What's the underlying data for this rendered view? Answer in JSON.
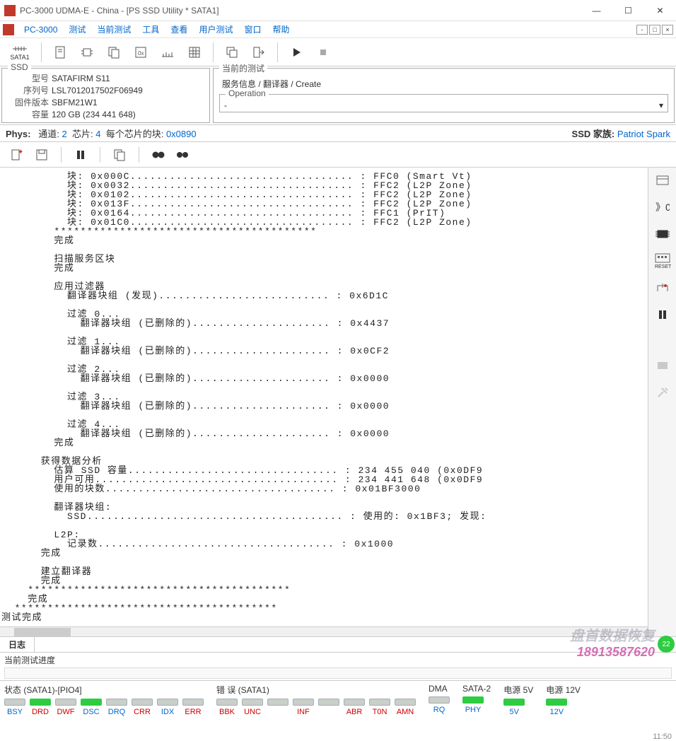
{
  "titlebar": {
    "title": "PC-3000 UDMA-E - China - [PS SSD Utility * SATA1]"
  },
  "menubar": {
    "items": [
      "PC-3000",
      "测试",
      "当前测试",
      "工具",
      "查看",
      "用户测试",
      "窗口",
      "帮助"
    ]
  },
  "toolbar": {
    "sata_label": "SATA1"
  },
  "ssd_panel": {
    "title": "SSD",
    "rows": [
      {
        "label": "型号",
        "value": "SATAFIRM   S11"
      },
      {
        "label": "序列号",
        "value": "LSL7012017502F06949"
      },
      {
        "label": "固件版本",
        "value": "SBFM21W1"
      },
      {
        "label": "容量",
        "value": "120 GB (234 441 648)"
      }
    ]
  },
  "current_test": {
    "title": "当前的测试",
    "breadcrumb": "服务信息 / 翻译器 / Create",
    "op_title": "Operation",
    "op_value": "-"
  },
  "phys": {
    "label": "Phys:",
    "ch_label": "通道:",
    "ch_val": "2",
    "chip_label": "芯片:",
    "chip_val": "4",
    "blk_label": "每个芯片的块:",
    "blk_val": "0x0890",
    "ssd_family_label": "SSD 家族:",
    "ssd_family_val": "Patriot Spark"
  },
  "log": "          块: 0x000C.................................. : FFC0 (Smart Vt)\n          块: 0x0032.................................. : FFC2 (L2P Zone)\n          块: 0x0102.................................. : FFC2 (L2P Zone)\n          块: 0x013F.................................. : FFC2 (L2P Zone)\n          块: 0x0164.................................. : FFC1 (PrIT)\n          块: 0x01C0.................................. : FFC2 (L2P Zone)\n        ****************************************\n        完成\n\n        扫描服务区块\n        完成\n\n        应用过滤器\n          翻译器块组 (发现).......................... : 0x6D1C\n\n          过滤 0...\n            翻译器块组 (已删除的)..................... : 0x4437\n\n          过滤 1...\n            翻译器块组 (已删除的)..................... : 0x0CF2\n\n          过滤 2...\n            翻译器块组 (已删除的)..................... : 0x0000\n\n          过滤 3...\n            翻译器块组 (已删除的)..................... : 0x0000\n\n          过滤 4...\n            翻译器块组 (已删除的)..................... : 0x0000\n        完成\n\n      获得数据分析\n        估算 SSD 容量................................ : 234 455 040 (0x0DF9\n        用户可用..................................... : 234 441 648 (0x0DF9\n        使用的块数................................... : 0x01BF3000\n\n        翻译器块组:\n          SSD....................................... : 使用的: 0x1BF3; 发现:\n\n        L2P:\n          记录数.................................... : 0x1000\n      完成\n\n      建立翻译器\n      完成\n    ****************************************\n    完成\n  ****************************************\n测试完成\n",
  "tabs": {
    "log": "日志"
  },
  "progress": {
    "label": "当前测试进度"
  },
  "status": {
    "groups": [
      {
        "title": "状态 (SATA1)-[PIO4]",
        "leds": [
          {
            "label": "BSY",
            "cls": "blue",
            "on": false
          },
          {
            "label": "DRD",
            "cls": "red",
            "on": true
          },
          {
            "label": "DWF",
            "cls": "red",
            "on": false
          },
          {
            "label": "DSC",
            "cls": "blue",
            "on": true
          },
          {
            "label": "DRQ",
            "cls": "blue",
            "on": false
          },
          {
            "label": "CRR",
            "cls": "red",
            "on": false
          },
          {
            "label": "IDX",
            "cls": "blue",
            "on": false
          },
          {
            "label": "ERR",
            "cls": "red",
            "on": false
          }
        ]
      },
      {
        "title": "错 误 (SATA1)",
        "leds": [
          {
            "label": "BBK",
            "cls": "red",
            "on": false
          },
          {
            "label": "UNC",
            "cls": "red",
            "on": false
          },
          {
            "label": "",
            "cls": "red",
            "on": false
          },
          {
            "label": "INF",
            "cls": "red",
            "on": false
          },
          {
            "label": "",
            "cls": "red",
            "on": false
          },
          {
            "label": "ABR",
            "cls": "red",
            "on": false
          },
          {
            "label": "T0N",
            "cls": "red",
            "on": false
          },
          {
            "label": "AMN",
            "cls": "red",
            "on": false
          }
        ]
      },
      {
        "title": "DMA",
        "leds": [
          {
            "label": "RQ",
            "cls": "blue",
            "on": false
          }
        ]
      },
      {
        "title": "SATA-2",
        "leds": [
          {
            "label": "PHY",
            "cls": "blue",
            "on": true
          }
        ]
      },
      {
        "title": "电源 5V",
        "leds": [
          {
            "label": "5V",
            "cls": "blue",
            "on": true
          }
        ]
      },
      {
        "title": "电源 12V",
        "leds": [
          {
            "label": "12V",
            "cls": "blue",
            "on": true
          }
        ]
      }
    ]
  },
  "watermark": {
    "line1": "盘首数据恢复",
    "line2": "18913587620"
  },
  "green_circle": "22",
  "clock": "11:50"
}
